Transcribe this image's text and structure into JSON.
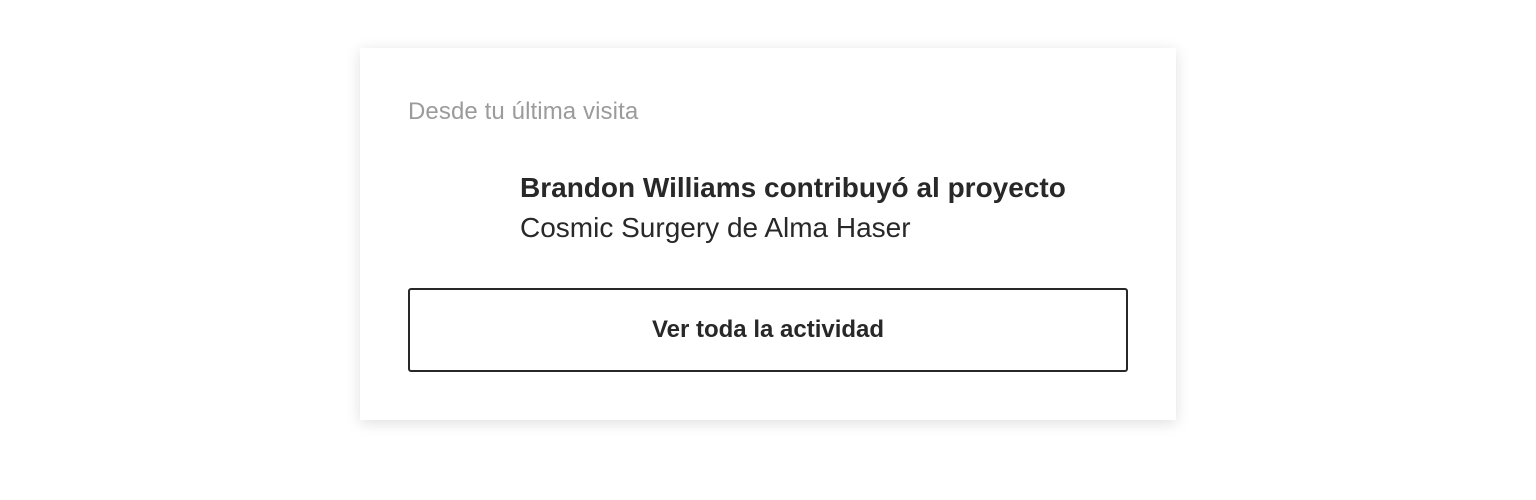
{
  "card": {
    "section_title": "Desde tu última visita",
    "activity": {
      "headline": "Brandon Williams contribuyó al proyecto",
      "detail": "Cosmic Surgery de Alma Haser"
    },
    "view_all_label": "Ver toda la actividad"
  },
  "colors": {
    "text": "#282828",
    "muted": "#9b9b9b",
    "background": "#ffffff"
  }
}
